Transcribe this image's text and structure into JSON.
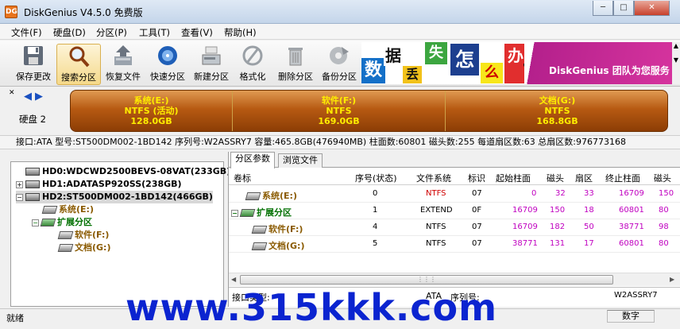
{
  "window": {
    "title": "DiskGenius V4.5.0 免费版",
    "icon": "DG",
    "min": "─",
    "max": "□",
    "close": "✕"
  },
  "menu": [
    "文件(F)",
    "硬盘(D)",
    "分区(P)",
    "工具(T)",
    "查看(V)",
    "帮助(H)"
  ],
  "toolbar": [
    {
      "label": "保存更改",
      "icon": "save-icon"
    },
    {
      "label": "搜索分区",
      "icon": "search-icon"
    },
    {
      "label": "恢复文件",
      "icon": "recover-icon"
    },
    {
      "label": "快速分区",
      "icon": "quick-partition-icon"
    },
    {
      "label": "新建分区",
      "icon": "new-partition-icon"
    },
    {
      "label": "格式化",
      "icon": "format-icon"
    },
    {
      "label": "删除分区",
      "icon": "delete-icon"
    },
    {
      "label": "备份分区",
      "icon": "backup-icon"
    }
  ],
  "banner": {
    "chars": [
      "数",
      "据",
      "丢",
      "失",
      "怎",
      "么",
      "办"
    ],
    "text": "DiskGenius 团队为您服务",
    "question": "?"
  },
  "disk": {
    "label": "硬盘 2",
    "parts": [
      {
        "name": "系统(E:)",
        "fs": "NTFS (活动)",
        "size": "128.0GB"
      },
      {
        "name": "软件(F:)",
        "fs": "NTFS",
        "size": "169.0GB"
      },
      {
        "name": "文档(G:)",
        "fs": "NTFS",
        "size": "168.8GB"
      }
    ]
  },
  "diskinfo": "接口:ATA   型号:ST500DM002-1BD142   序列号:W2ASSRY7   容量:465.8GB(476940MB)   柱面数:60801   磁头数:255   每道扇区数:63   总扇区数:976773168",
  "tree": [
    {
      "text": "HD0:WDCWD2500BEVS-08VAT(233GB)"
    },
    {
      "text": "HD1:ADATASP920SS(238GB)"
    },
    {
      "text": "HD2:ST500DM002-1BD142(466GB)"
    },
    {
      "text": "系统(E:)"
    },
    {
      "text": "扩展分区"
    },
    {
      "text": "软件(F:)"
    },
    {
      "text": "文档(G:)"
    }
  ],
  "tabs": [
    "分区参数",
    "浏览文件"
  ],
  "columns": [
    "卷标",
    "序号(状态)",
    "文件系统",
    "标识",
    "起始柱面",
    "磁头",
    "扇区",
    "终止柱面",
    "磁头"
  ],
  "rows": [
    {
      "label": "系统(E:)",
      "num": "0",
      "fs": "NTFS",
      "id": "07",
      "sc": "0",
      "sh": "32",
      "ss": "33",
      "ec": "16709",
      "eh": "150"
    },
    {
      "label": "扩展分区",
      "num": "1",
      "fs": "EXTEND",
      "id": "0F",
      "sc": "16709",
      "sh": "150",
      "ss": "18",
      "ec": "60801",
      "eh": "80"
    },
    {
      "label": "软件(F:)",
      "num": "4",
      "fs": "NTFS",
      "id": "07",
      "sc": "16709",
      "sh": "182",
      "ss": "50",
      "ec": "38771",
      "eh": "98"
    },
    {
      "label": "文档(G:)",
      "num": "5",
      "fs": "NTFS",
      "id": "07",
      "sc": "38771",
      "sh": "131",
      "ss": "17",
      "ec": "60801",
      "eh": "80"
    }
  ],
  "detail": {
    "iface_label": "接口类型:",
    "iface": "ATA",
    "serial_label": "序列号:",
    "serial": "W2ASSRY7"
  },
  "status": {
    "text": "就绪",
    "mode": "数字"
  },
  "watermark": "www.315kkk.com"
}
